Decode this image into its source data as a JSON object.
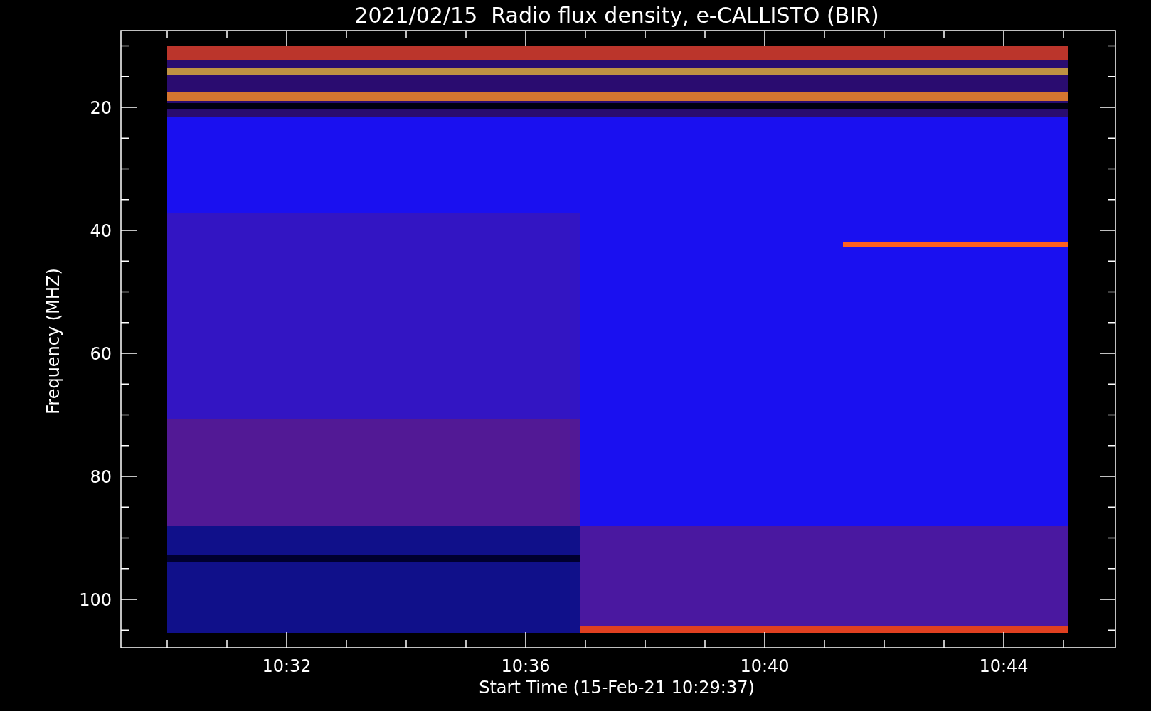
{
  "title": "2021/02/15  Radio flux density, e-CALLISTO (BIR)",
  "plot": {
    "ylabel": "Frequency (MHZ)",
    "xlabel": "Start Time (15-Feb-21 10:29:37)",
    "yticks": [
      "20",
      "40",
      "60",
      "80",
      "100"
    ],
    "xticks": [
      "10:32",
      "10:36",
      "10:40",
      "10:44"
    ]
  }
}
